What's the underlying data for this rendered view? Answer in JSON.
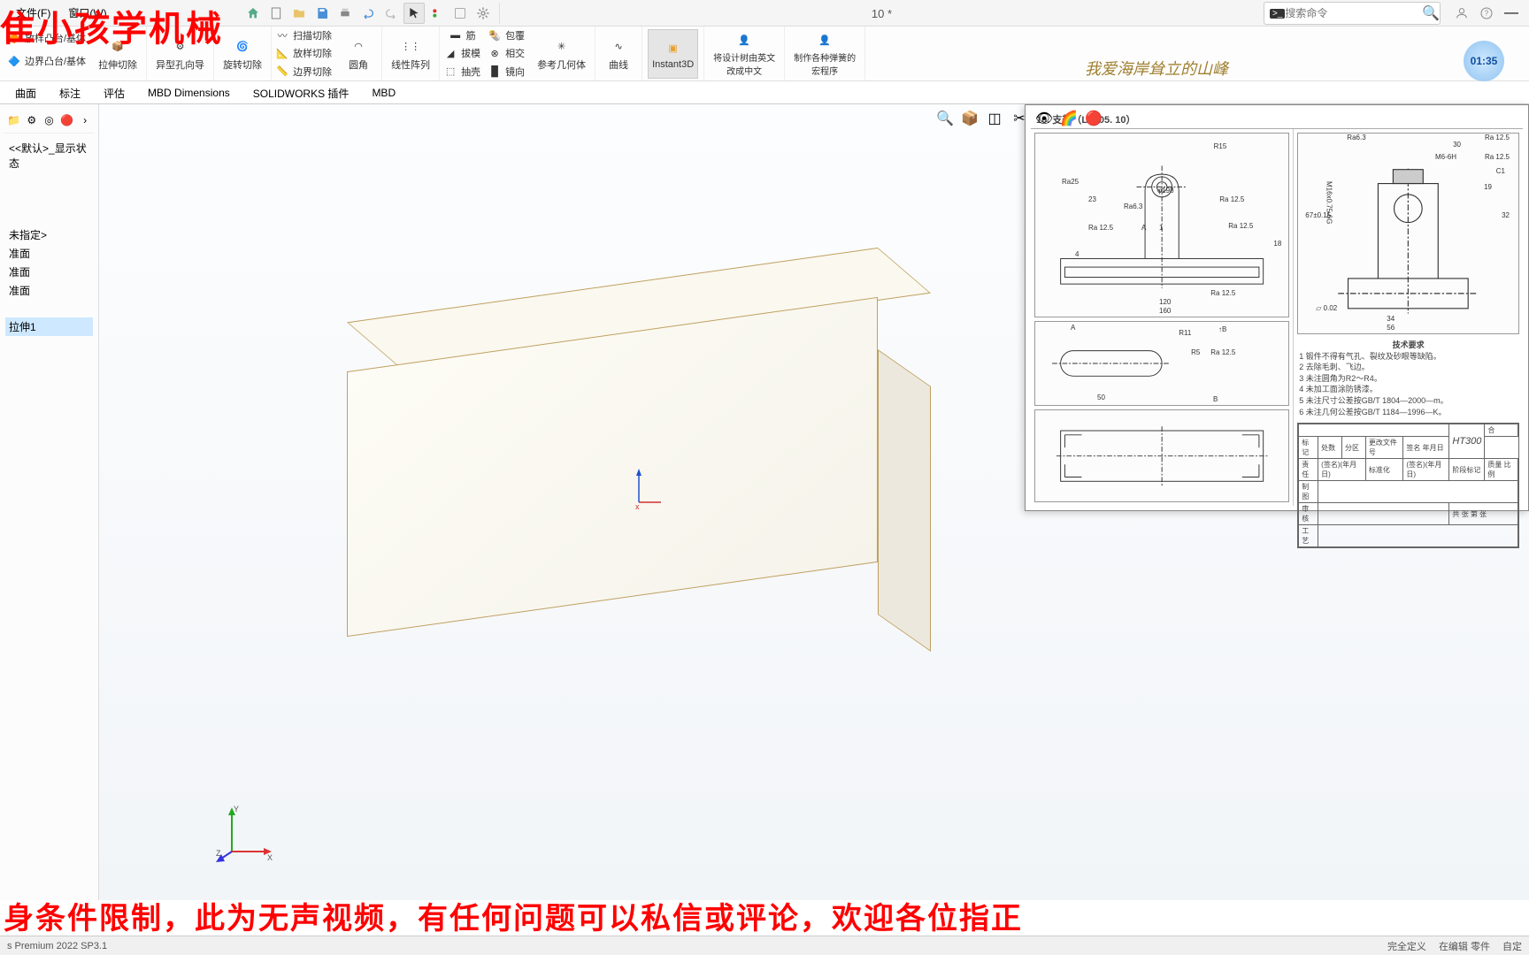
{
  "menubar": {
    "file": "文件(F)",
    "window": "窗口(W)"
  },
  "toolbar": {
    "title": "10 *",
    "search_placeholder": "搜索命令"
  },
  "ribbon": {
    "boss": "放样凸台/基体",
    "boundary": "边界凸台/基体",
    "sweep_cut": "扫描切除",
    "extrude_cut": "拉伸切除",
    "hole": "异型孔向导",
    "revolve_cut": "旋转切除",
    "loft_cut": "放样切除",
    "boundary_cut": "边界切除",
    "fillet": "圆角",
    "linear_pattern": "线性阵列",
    "rib": "筋",
    "draft": "拔模",
    "shell": "抽壳",
    "wrap": "包覆",
    "intersect": "相交",
    "mirror": "镜向",
    "refgeom": "参考几何体",
    "curve": "曲线",
    "instant3d": "Instant3D",
    "translate": "将设计树由英文改成中文",
    "macro": "制作各种弹簧的宏程序"
  },
  "tabs": {
    "surface": "曲面",
    "annotate": "标注",
    "evaluate": "评估",
    "mbd_dim": "MBD Dimensions",
    "sw_addin": "SOLIDWORKS 插件",
    "mbd": "MBD"
  },
  "tree": {
    "state": "<<默认>_显示状态",
    "unspecified": "未指定>",
    "plane1": "准面",
    "plane2": "准面",
    "plane3": "准面",
    "feature1": "拉伸1"
  },
  "drawing": {
    "title": "10. 支架（LJT05. 10）",
    "dims": {
      "r15": "R15",
      "ra63": "Ra6.3",
      "ra25": "Ra25",
      "d23": "23",
      "phi198": "φ198",
      "ra125": "Ra 12.5",
      "a": "A",
      "one": "1",
      "four": "4",
      "one20": "120",
      "one60": "160",
      "one8": "18",
      "r11": "R11",
      "b": "B",
      "r5": "R5",
      "fifty": "50",
      "thirty": "30",
      "m6": "M6-6H",
      "c1": "C1",
      "nineteen": "19",
      "m16": "M16x0.75-6G",
      "sixtyseven": "67±0.15",
      "thirtytwo": "32",
      "tol": "0.02",
      "thirtyfour": "34",
      "fiftysix": "56"
    },
    "tech_title": "技术要求",
    "tech": {
      "r1": "1 锻件不得有气孔、裂纹及砂眼等缺陷。",
      "r2": "2 去除毛刺、飞边。",
      "r3": "3 未注圆角为R2～R4。",
      "r4": "4 未加工面涂防锈漆。",
      "r5": "5 未注尺寸公差按GB/T 1804—2000—m。",
      "r6": "6 未注几何公差按GB/T 1184—1996—K。"
    },
    "material": "HT300",
    "tb": {
      "mark": "标记",
      "qty": "处数",
      "zone": "分区",
      "doc": "更改文件号",
      "sign": "签名",
      "date": "年月日",
      "design": "责任",
      "std": "标准化",
      "stage": "阶段标记",
      "weight": "质量",
      "scale": "比例",
      "draw": "制图",
      "check": "审核",
      "total": "共 张  第 张",
      "tech": "工艺"
    }
  },
  "status": {
    "version": "s Premium 2022 SP3.1",
    "define": "完全定义",
    "edit": "在编辑 零件",
    "custom": "自定"
  },
  "overlay": {
    "top_left": "隹小孩学机械",
    "signature": "我爱海岸耸立的山峰",
    "bottom": "身条件限制，此为无声视频，有任何问题可以私信或评论，欢迎各位指正",
    "timer": "01:35"
  }
}
